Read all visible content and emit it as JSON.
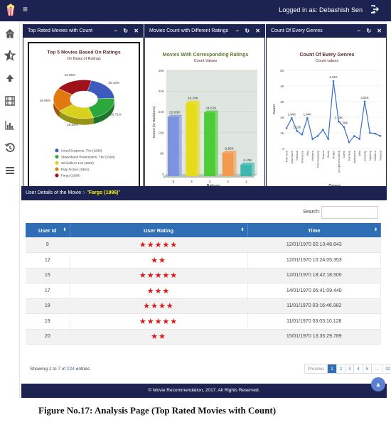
{
  "header": {
    "user_label": "Logged in as: Debashish Sen",
    "menu_glyph": "≡"
  },
  "sidebar": {
    "items": [
      {
        "icon": "home-icon"
      },
      {
        "icon": "star-icon"
      },
      {
        "icon": "arrow-up-icon"
      },
      {
        "icon": "film-icon"
      },
      {
        "icon": "bar-chart-icon"
      },
      {
        "icon": "history-icon"
      },
      {
        "icon": "list-icon"
      }
    ]
  },
  "panels": {
    "p1": {
      "title": "Top Rated Movies with Count"
    },
    "p2": {
      "title": "Movies Count with Different Ratings"
    },
    "p3": {
      "title": "Count Of Every Genres"
    },
    "tools": [
      "–",
      "↻",
      "✕"
    ]
  },
  "chart_data": [
    {
      "type": "pie",
      "title": "Top 5 Movies Based On Ratings",
      "subtitle": "On Basis of Ratings",
      "categories": [
        "Usual Suspects, The (1995)",
        "Shawshank Redemption, The (1994)",
        "Schindler's List (1993)",
        "Pulp Fiction (1994)",
        "Fargo (1996)"
      ],
      "values": [
        20.16,
        20.71,
        19.83,
        19.65,
        19.65
      ],
      "data_labels": [
        "20.16%",
        "20.71%",
        "19.83%",
        "19.65%",
        "19.65%"
      ],
      "colors": [
        "#3d5bbf",
        "#2aa83a",
        "#d8d21f",
        "#e07a10",
        "#a0121a"
      ],
      "legend": "bottom"
    },
    {
      "type": "bar",
      "title": "Movies With Corresponding Ratings",
      "subtitle": "Count Values",
      "categories": [
        "5",
        "4",
        "3",
        "2",
        "1"
      ],
      "values": [
        22.83,
        28.29,
        24.52,
        8.96,
        4.43
      ],
      "data_labels": [
        "22.83K",
        "28.29K",
        "24.52K",
        "8.96K",
        "4.43K"
      ],
      "ylim": [
        0,
        40
      ],
      "yticks": [
        "0",
        "8K",
        "16K",
        "24K",
        "32K",
        "40K"
      ],
      "xlabel": "Ratings",
      "ylabel": "Count (in Numbers)",
      "colors": [
        "#7e93e0",
        "#e6dc1a",
        "#4ecc37",
        "#f29a4f",
        "#3fb6b0"
      ],
      "watermark": "FusionCharts XT Trial"
    },
    {
      "type": "line",
      "title": "Count Of Every Genres",
      "subtitle": "Count values",
      "categories": [
        "Film-Noir",
        "Adventure",
        "Musical",
        "Romance",
        "War",
        "Western",
        "Documentary",
        "Drama",
        "South",
        "Thriller",
        "(no genres listed)",
        "Crime",
        "Fantasy",
        "Animation",
        "Mixt",
        "Comedy",
        "Mystery",
        "Children",
        "Musical"
      ],
      "values": [
        1.3,
        1.94,
        1.12,
        0.9,
        1.94,
        0.6,
        0.8,
        1.2,
        0.6,
        4.31,
        1.73,
        1.38,
        0.4,
        0.8,
        0.6,
        3.01,
        1.0,
        0.95,
        0.8
      ],
      "data_labels": [
        "1.94K",
        "1.12K",
        "1.94K",
        "4.31K",
        "1.73K",
        "1.38K",
        "3.01K"
      ],
      "ylim": [
        0,
        5
      ],
      "yticks": [
        "0",
        "1K",
        "2K",
        "3K",
        "4K",
        "5K"
      ],
      "xlabel": "Genres",
      "ylabel": "Count",
      "color": "#3a6fc6",
      "watermark": "FusionCharts XT Trial"
    }
  ],
  "details": {
    "heading_prefix": "User Details of the Movie :- \"",
    "movie": "Fargo (1996)",
    "heading_suffix": "\"",
    "search_label": "Search:",
    "search_value": "",
    "columns": [
      "User Id",
      "User Rating",
      "Time"
    ],
    "rows": [
      {
        "user_id": "9",
        "stars": 5,
        "time": "12/01/1970 02:13:48.843"
      },
      {
        "user_id": "12",
        "stars": 2,
        "time": "12/01/1970 10:24:05.353"
      },
      {
        "user_id": "15",
        "stars": 5,
        "time": "12/01/1970 18:42:18.500"
      },
      {
        "user_id": "17",
        "stars": 3,
        "time": "14/01/1970 06:41:09.440"
      },
      {
        "user_id": "18",
        "stars": 4,
        "time": "11/01/1970 03:16:46.982"
      },
      {
        "user_id": "19",
        "stars": 5,
        "time": "11/01/1970 03:03:10.128"
      },
      {
        "user_id": "20",
        "stars": 2,
        "time": "15/01/1970 13:35:29.789"
      }
    ],
    "entries_prefix": "Showing 1 to 7 of ",
    "entries_total": "224",
    "entries_suffix": " entries",
    "pager": [
      "Previous",
      "1",
      "2",
      "3",
      "4",
      "5",
      "…",
      "32",
      "Next"
    ],
    "pager_active": "1"
  },
  "footer": {
    "text": "© Movie Recommendation, 2017. All Rights Reserved."
  },
  "back_to_top": "▲",
  "caption": "Figure No.17: Analysis Page (Top Rated Movies with Count)",
  "colors": {
    "navy": "#1c2350",
    "table_header": "#2f6db4",
    "star": "#e01515",
    "highlight": "#fff200"
  }
}
